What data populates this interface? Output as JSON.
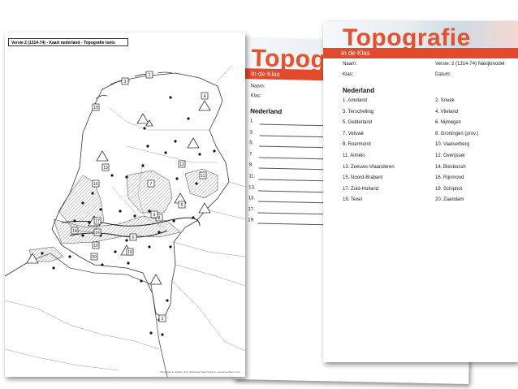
{
  "back_sheet": {
    "title": "Topogra",
    "subtitle": "In de Klas",
    "naam_label": "Naam:",
    "klas_label": "Klas:",
    "section": "Nederland",
    "numbers": [
      "1.",
      "3.",
      "5.",
      "7.",
      "9.",
      "11.",
      "13.",
      "15.",
      "17.",
      "19."
    ]
  },
  "front_sheet": {
    "title": "Topografie",
    "subtitle": "In de Klas",
    "naam_label": "Naam:",
    "klas_label": "Klas:",
    "version_label": "Versie: 2 (1314-74) Nakijkmodel",
    "datum_label": "Datum:",
    "section": "Nederland",
    "left_items": [
      "1. Ameland",
      "3. Terschelling",
      "5. Gelderland",
      "7. Veluwe",
      "9. Roermond",
      "11. Almelo",
      "13. Zeeuws-Vlaanderen",
      "15. Noord-Brabant",
      "17. Zuid-Holland",
      "19. Texel"
    ],
    "right_items": [
      "2. Sneek",
      "4. Vlieland",
      "6. Nijmegen",
      "8. Groningen (prov.)",
      "10. Vaalserberg",
      "12. Overijssel",
      "14. Biesbosch",
      "16. Rijnmond",
      "18. Schiphol",
      "20. Zaandam"
    ]
  },
  "map_sheet": {
    "header": "Versie 2 (1314-74) - Kaart nederland - Topografie toets",
    "footer": "Topografie in de klas, Stor Nederland, Natural Earth, www.ateachfarm.com",
    "box_labels": [
      "3",
      "1",
      "19",
      "4",
      "7",
      "12",
      "15",
      "13",
      "11",
      "5",
      "17",
      "14",
      "18",
      "16",
      "2",
      "6",
      "8",
      "10",
      "9",
      "20"
    ]
  }
}
